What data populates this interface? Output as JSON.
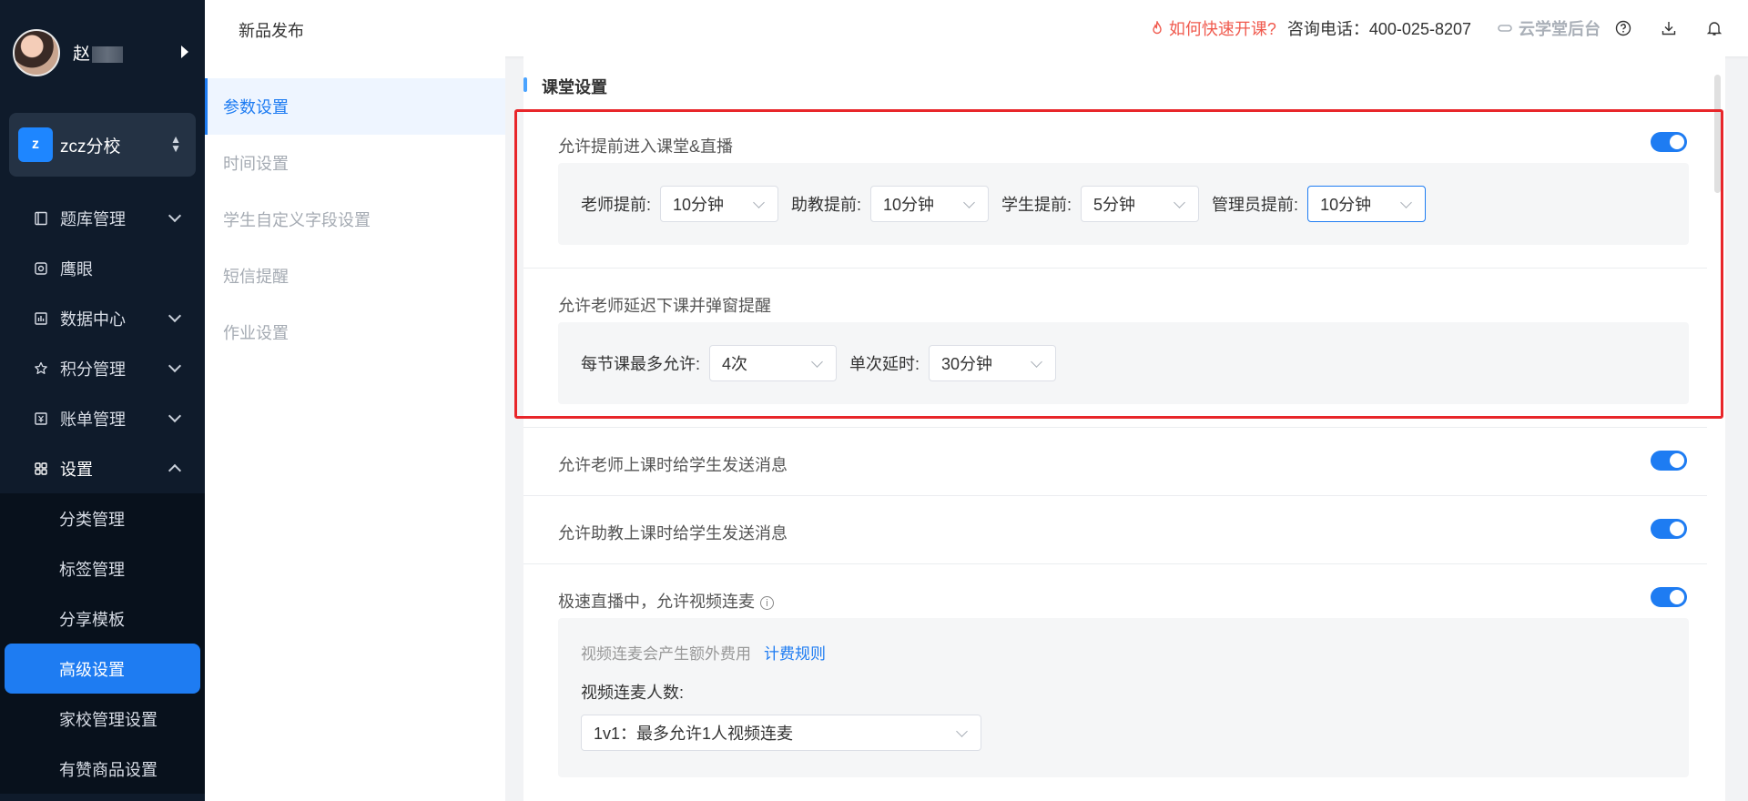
{
  "user": {
    "name": "赵"
  },
  "school": {
    "badge": "z",
    "name": "zcz分校"
  },
  "menu": [
    {
      "label": "题库管理",
      "icon": "book-icon"
    },
    {
      "label": "鹰眼",
      "icon": "eye-icon"
    },
    {
      "label": "数据中心",
      "icon": "chart-icon"
    },
    {
      "label": "积分管理",
      "icon": "star-icon"
    },
    {
      "label": "账单管理",
      "icon": "bill-icon"
    },
    {
      "label": "设置",
      "icon": "grid-icon"
    }
  ],
  "submenu": [
    "分类管理",
    "标签管理",
    "分享模板",
    "高级设置",
    "家校管理设置",
    "有赞商品设置"
  ],
  "header": {
    "title": "新品发布",
    "quick_start": "如何快速开课?",
    "phone": "咨询电话：400-025-8207",
    "brand": "云学堂后台"
  },
  "subnav": [
    "参数设置",
    "时间设置",
    "学生自定义字段设置",
    "短信提醒",
    "作业设置"
  ],
  "main": {
    "section_title": "课堂设置",
    "early_enter": {
      "label": "允许提前进入课堂&直播",
      "fields": [
        {
          "label": "老师提前:",
          "value": "10分钟"
        },
        {
          "label": "助教提前:",
          "value": "10分钟"
        },
        {
          "label": "学生提前:",
          "value": "5分钟"
        },
        {
          "label": "管理员提前:",
          "value": "10分钟"
        }
      ]
    },
    "delay": {
      "label": "允许老师延迟下课并弹窗提醒",
      "fields": [
        {
          "label": "每节课最多允许:",
          "value": "4次"
        },
        {
          "label": "单次延时:",
          "value": "30分钟"
        }
      ]
    },
    "teacher_msg": "允许老师上课时给学生发送消息",
    "assistant_msg": "允许助教上课时给学生发送消息",
    "video_link": {
      "label": "极速直播中，允许视频连麦",
      "note": "视频连麦会产生额外费用",
      "link": "计费规则",
      "count_label": "视频连麦人数:",
      "count_value": "1v1：最多允许1人视频连麦"
    }
  }
}
